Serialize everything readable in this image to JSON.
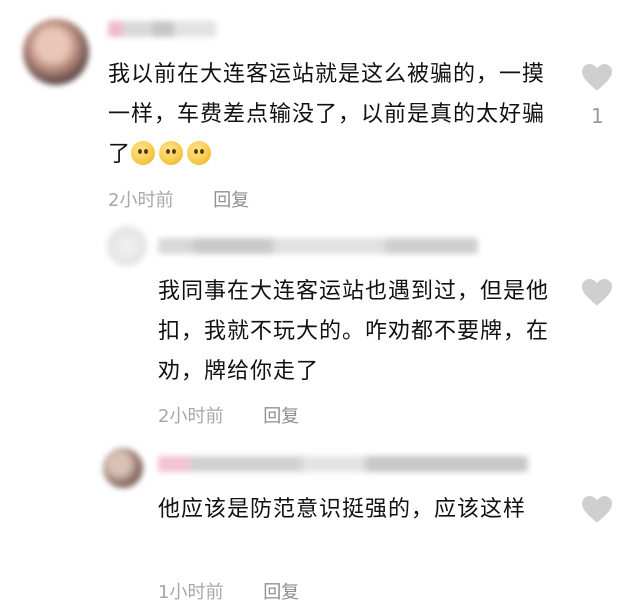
{
  "comments": [
    {
      "text": "我以前在大连客运站就是这么被骗的，一摸一样，车费差点输没了，以前是真的太好骗了",
      "time": "2小时前",
      "reply": "回复",
      "likes": "1",
      "emoji_count": 3
    },
    {
      "text": "我同事在大连客运站也遇到过，但是他扣，我就不玩大的。咋劝都不要牌，在劝，牌给你走了",
      "time": "2小时前",
      "reply": "回复"
    },
    {
      "text": "他应该是防范意识挺强的，应该这样",
      "time": "1小时前",
      "reply": "回复"
    }
  ],
  "colors": {
    "heart": "#cfcfcf",
    "meta": "#a8a8a8",
    "text": "#111111"
  }
}
